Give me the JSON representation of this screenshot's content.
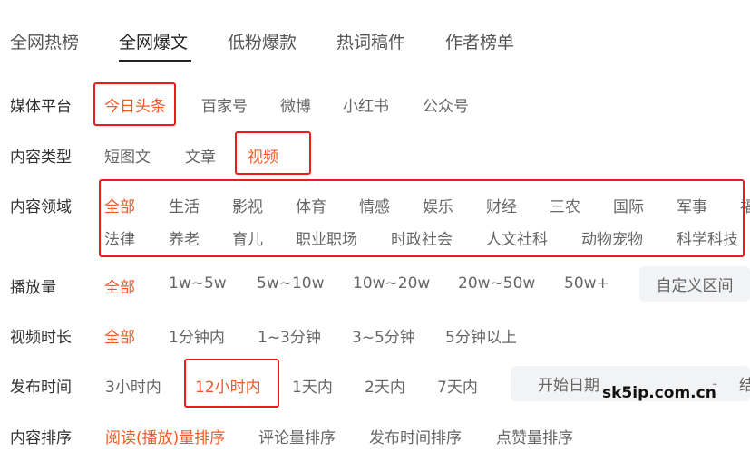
{
  "tabs": [
    {
      "label": "全网热榜",
      "active": false
    },
    {
      "label": "全网爆文",
      "active": true
    },
    {
      "label": "低粉爆款",
      "active": false
    },
    {
      "label": "热词稿件",
      "active": false
    },
    {
      "label": "作者榜单",
      "active": false
    }
  ],
  "filters": {
    "platform": {
      "label": "媒体平台",
      "options": [
        "今日头条",
        "百家号",
        "微博",
        "小红书",
        "公众号"
      ],
      "selected": "今日头条"
    },
    "content_type": {
      "label": "内容类型",
      "options": [
        "短图文",
        "文章",
        "视频"
      ],
      "selected": "视频"
    },
    "domain": {
      "label": "内容领域",
      "row1": [
        "全部",
        "生活",
        "影视",
        "体育",
        "情感",
        "娱乐",
        "财经",
        "三农",
        "国际",
        "军事",
        "福"
      ],
      "row2": [
        "法律",
        "养老",
        "育儿",
        "职业职场",
        "时政社会",
        "人文社科",
        "动物宠物",
        "科学科技"
      ],
      "selected": "全部"
    },
    "plays": {
      "label": "播放量",
      "options": [
        "全部",
        "1w~5w",
        "5w~10w",
        "10w~20w",
        "20w~50w",
        "50w+"
      ],
      "selected": "全部",
      "custom_range": "自定义区间"
    },
    "duration": {
      "label": "视频时长",
      "options": [
        "全部",
        "1分钟内",
        "1~3分钟",
        "3~5分钟",
        "5分钟以上"
      ],
      "selected": "全部"
    },
    "publish_time": {
      "label": "发布时间",
      "options": [
        "3小时内",
        "12小时内",
        "1天内",
        "2天内",
        "7天内"
      ],
      "selected": "12小时内",
      "start_date": "开始日期",
      "separator": "-",
      "end_date": "结"
    },
    "sort": {
      "label": "内容排序",
      "options": [
        "阅读(播放)量排序",
        "评论量排序",
        "发布时间排序",
        "点赞量排序"
      ],
      "selected": "阅读(播放)量排序"
    }
  },
  "watermark": "sk5ip.com.cn",
  "colors": {
    "selected": "#f05a28",
    "highlight_box": "#ea1c1c",
    "pill_bg": "#f2f3f5"
  }
}
